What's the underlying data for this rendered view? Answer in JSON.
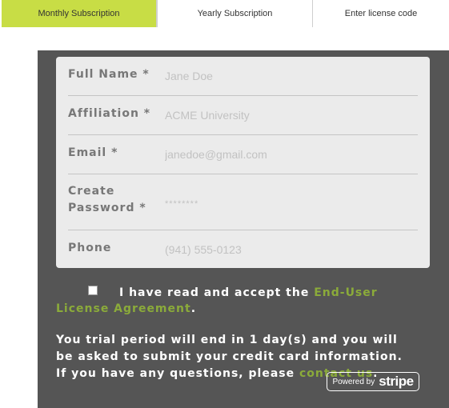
{
  "tabs": [
    "Monthly Subscription",
    "Yearly Subscription",
    "Enter license code"
  ],
  "form": {
    "full_name": {
      "label": "Full Name *",
      "placeholder": "Jane Doe"
    },
    "affiliation": {
      "label": "Affiliation *",
      "placeholder": "ACME University"
    },
    "email": {
      "label": "Email *",
      "placeholder": "janedoe@gmail.com"
    },
    "password": {
      "label_line1": "Create",
      "label_line2": "Password *",
      "placeholder": "********"
    },
    "phone": {
      "label": "Phone",
      "placeholder": "(941) 555-0123"
    }
  },
  "accept": {
    "text": "I have read and accept the",
    "link": "End-User License Agreement",
    "suffix": "."
  },
  "notice": {
    "text": "You trial period will end in 1 day(s) and you will be asked to submit your credit card information. If you have any questions, please",
    "link": "contact us",
    "suffix": "."
  },
  "stripe_badge": {
    "powered_by": "Powered by",
    "brand": "stripe"
  },
  "colors": {
    "active_tab": "#c8dd45",
    "panel": "#555555",
    "link": "#8bab3a"
  }
}
